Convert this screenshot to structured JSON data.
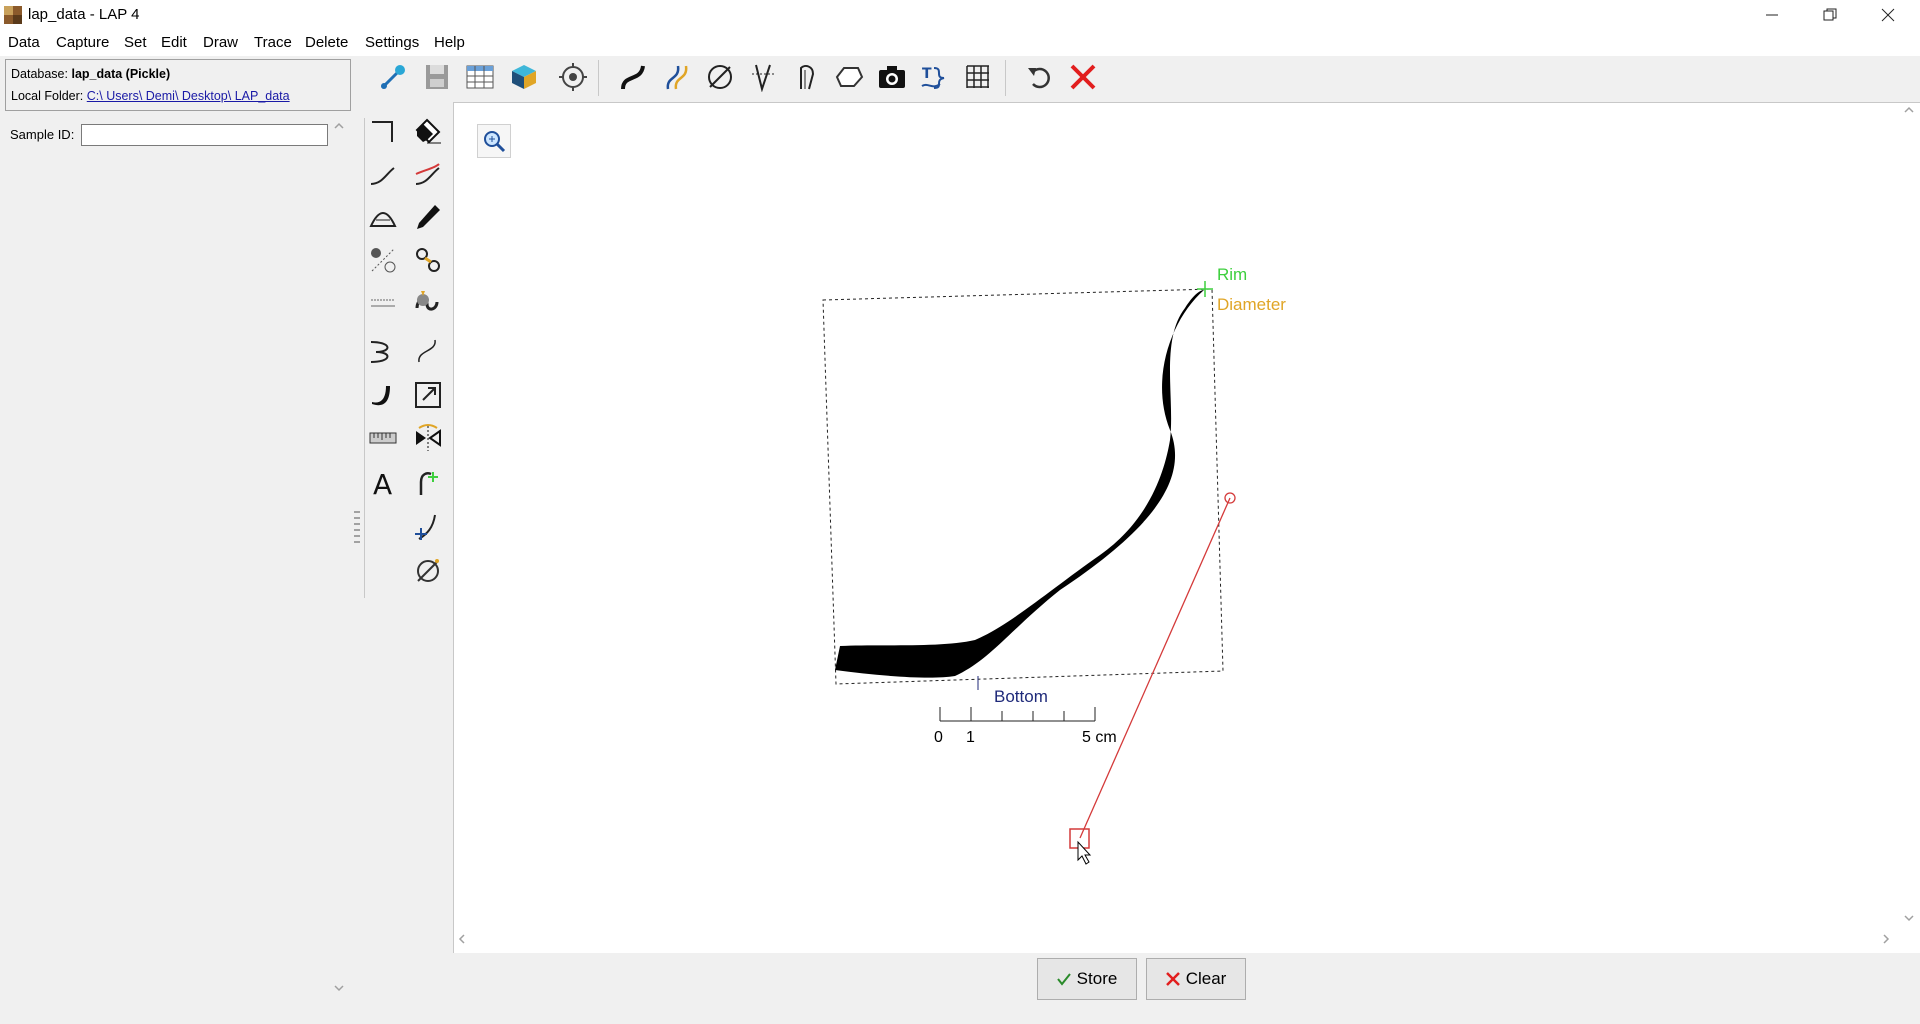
{
  "window": {
    "title": "lap_data - LAP 4"
  },
  "menu": [
    "Data",
    "Capture",
    "Set",
    "Edit",
    "Draw",
    "Trace",
    "Delete",
    "Settings",
    "Help"
  ],
  "database": {
    "db_label": "Database:",
    "db_value": "lap_data (Pickle)",
    "folder_label": "Local Folder:",
    "folder_value": "C:\\ Users\\ Demi\\ Desktop\\ LAP_data"
  },
  "sample": {
    "label": "Sample ID:",
    "value": ""
  },
  "canvas": {
    "labels": {
      "rim": "Rim",
      "diameter": "Diameter",
      "bottom": "Bottom"
    },
    "scale": {
      "tick0": "0",
      "tick1": "1",
      "tick5": "5 cm"
    },
    "colors": {
      "rim": "#3ecf3e",
      "diameter": "#e0a526",
      "bottom": "#1f2a7a",
      "guide": "#d43a3a"
    }
  },
  "buttons": {
    "store": "Store",
    "clear": "Clear",
    "store_icon": "check-icon",
    "clear_icon": "x-icon"
  },
  "colors": {
    "accent_red": "#e21e1e",
    "link": "#1a1aa6"
  }
}
